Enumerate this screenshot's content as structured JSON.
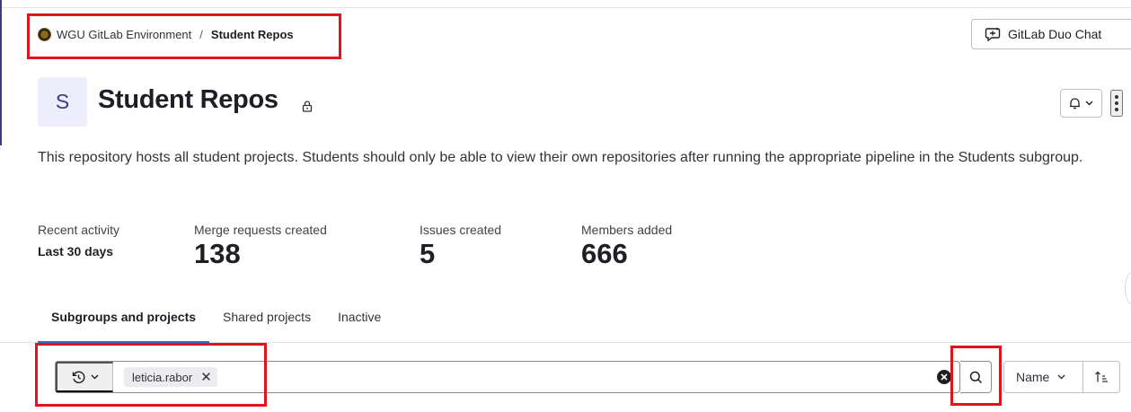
{
  "breadcrumb": {
    "parent": "WGU GitLab Environment",
    "separator": "/",
    "current": "Student Repos"
  },
  "header": {
    "duo_chat_label": "GitLab Duo Chat"
  },
  "group": {
    "avatar_letter": "S",
    "title": "Student Repos",
    "description": "This repository hosts all student projects. Students should only be able to view their own repositories after running the appropriate pipeline in the Students subgroup."
  },
  "stats": {
    "period_label": "Recent activity",
    "period_value": "Last 30 days",
    "items": [
      {
        "label": "Merge requests created",
        "value": "138"
      },
      {
        "label": "Issues created",
        "value": "5"
      },
      {
        "label": "Members added",
        "value": "666"
      }
    ]
  },
  "tabs": [
    {
      "label": "Subgroups and projects",
      "active": true
    },
    {
      "label": "Shared projects",
      "active": false
    },
    {
      "label": "Inactive",
      "active": false
    }
  ],
  "search": {
    "token": "leticia.rabor",
    "token_remove_glyph": "✕"
  },
  "sort": {
    "field": "Name"
  },
  "colors": {
    "highlight": "#e0141e",
    "active_tab": "#1f75cb",
    "avatar_bg": "#eeedfb"
  }
}
